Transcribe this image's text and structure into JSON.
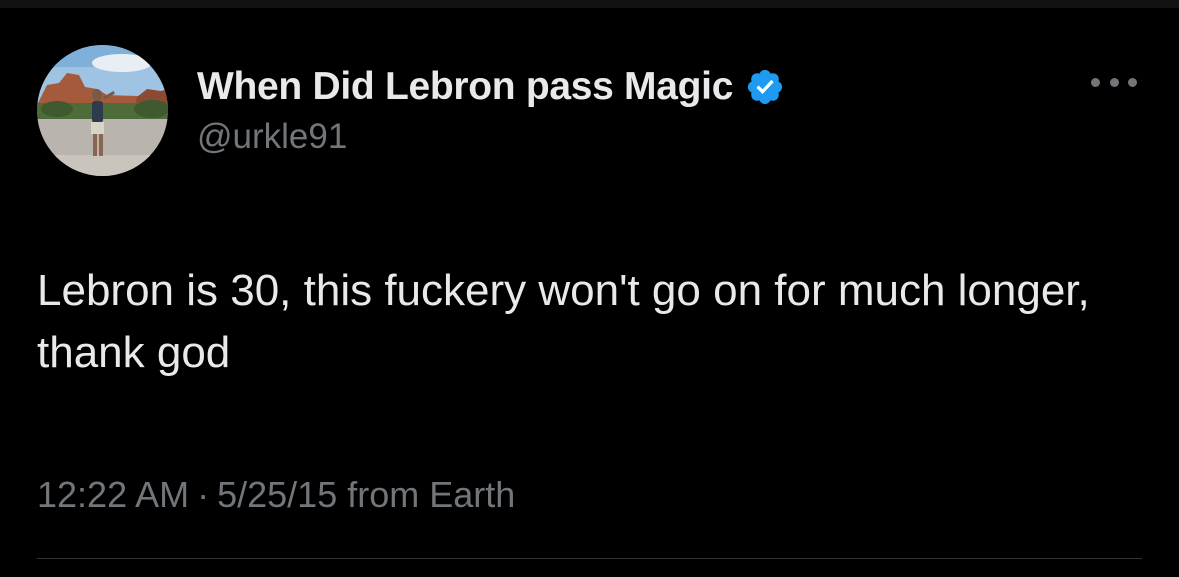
{
  "tweet": {
    "author": {
      "display_name": "When Did Lebron pass Magic",
      "handle": "@urkle91",
      "verified": true,
      "verified_icon": "verified-badge-icon",
      "avatar_icon": "avatar-photo"
    },
    "more_icon": "more-options-icon",
    "text": "Lebron is 30, this fuckery won't go on for much longer, thank god",
    "time": "12:22 AM",
    "separator": "·",
    "date": "5/25/15",
    "source": "from Earth"
  },
  "colors": {
    "background": "#000000",
    "text_primary": "#e7e9ea",
    "text_secondary": "#71767b",
    "verified_blue": "#1d9bf0",
    "divider": "#2f3336"
  }
}
